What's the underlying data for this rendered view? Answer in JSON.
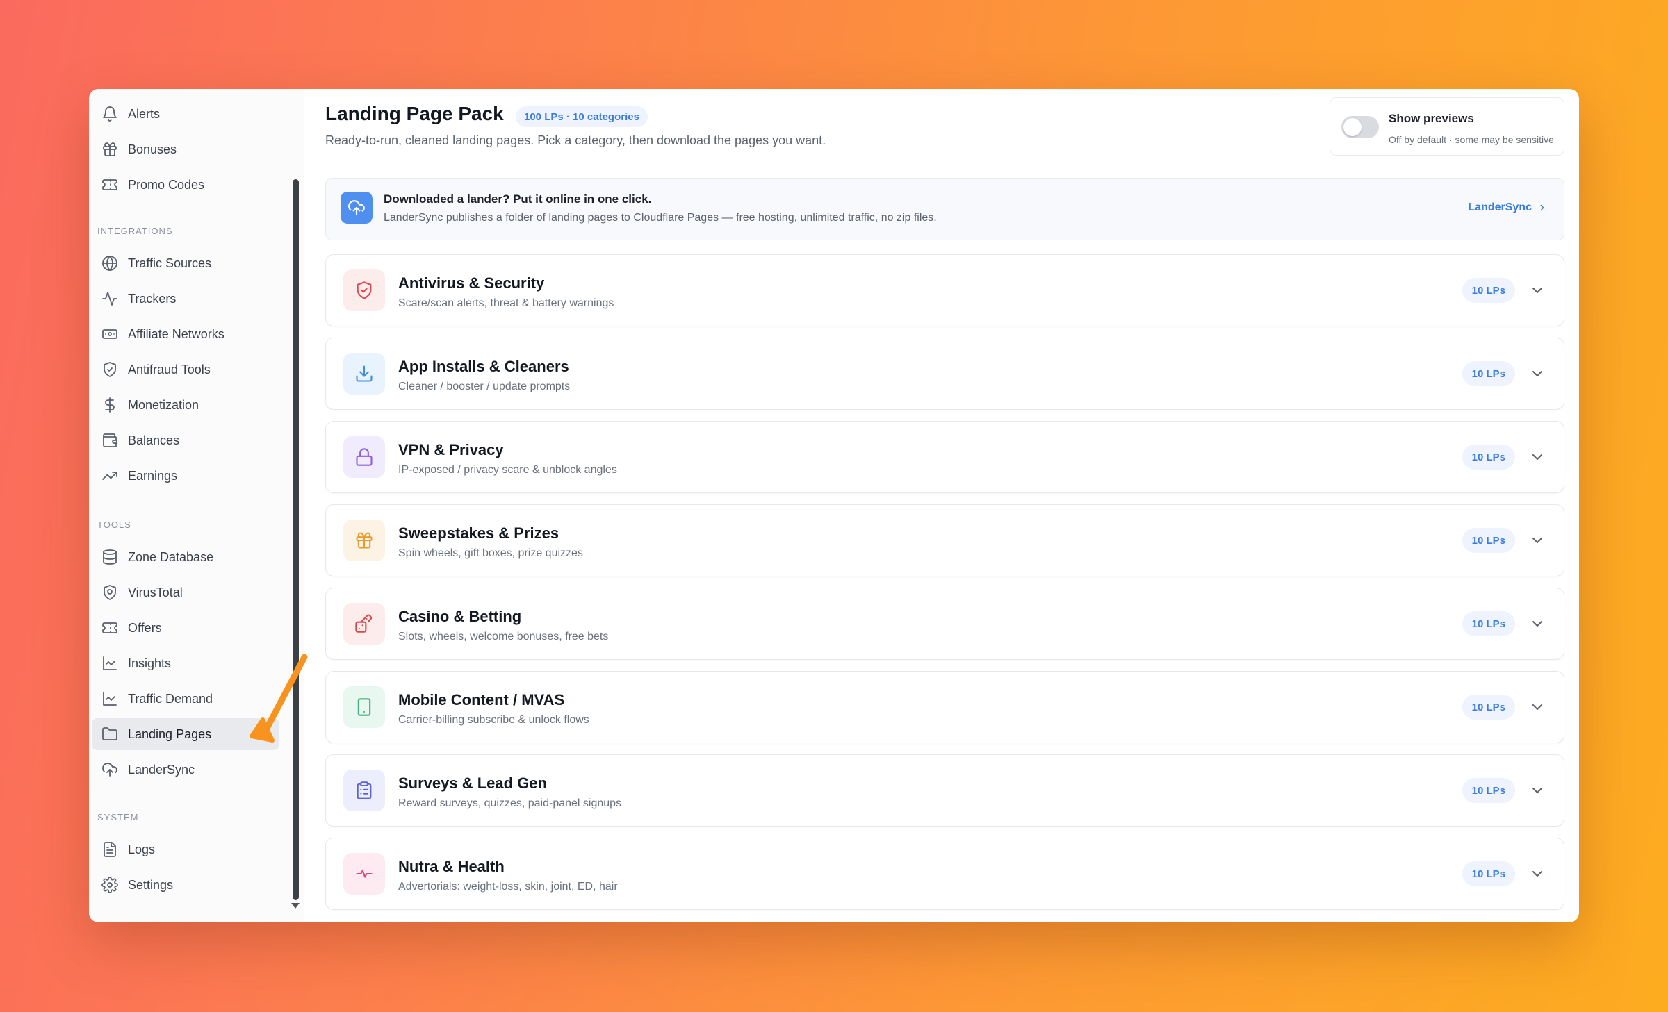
{
  "sidebar": {
    "sections": [
      {
        "label": "INTEGRATIONS"
      },
      {
        "label": "TOOLS"
      },
      {
        "label": "SYSTEM"
      }
    ],
    "items": [
      {
        "label": "Alerts",
        "icon": "bell-icon"
      },
      {
        "label": "Bonuses",
        "icon": "gift-icon"
      },
      {
        "label": "Promo Codes",
        "icon": "ticket-icon"
      },
      {
        "label": "Traffic Sources",
        "icon": "globe-icon"
      },
      {
        "label": "Trackers",
        "icon": "activity-icon"
      },
      {
        "label": "Affiliate Networks",
        "icon": "banknote-icon"
      },
      {
        "label": "Antifraud Tools",
        "icon": "shield-check-icon"
      },
      {
        "label": "Monetization",
        "icon": "dollar-icon"
      },
      {
        "label": "Balances",
        "icon": "wallet-icon"
      },
      {
        "label": "Earnings",
        "icon": "trending-up-icon"
      },
      {
        "label": "Zone Database",
        "icon": "database-icon"
      },
      {
        "label": "VirusTotal",
        "icon": "shield-scan-icon"
      },
      {
        "label": "Offers",
        "icon": "ticket-icon"
      },
      {
        "label": "Insights",
        "icon": "line-chart-icon"
      },
      {
        "label": "Traffic Demand",
        "icon": "line-chart-icon"
      },
      {
        "label": "Landing Pages",
        "icon": "folder-icon",
        "active": true
      },
      {
        "label": "LanderSync",
        "icon": "cloud-upload-icon"
      },
      {
        "label": "Logs",
        "icon": "file-text-icon"
      },
      {
        "label": "Settings",
        "icon": "gear-icon"
      }
    ]
  },
  "header": {
    "title": "Landing Page Pack",
    "badge": "100 LPs · 10 categories",
    "subtitle": "Ready-to-run, cleaned landing pages. Pick a category, then download the pages you want."
  },
  "previews": {
    "title": "Show previews",
    "subtitle": "Off by default · some may be sensitive",
    "enabled": false
  },
  "banner": {
    "title": "Downloaded a lander? Put it online in one click.",
    "text": "LanderSync publishes a folder of landing pages to Cloudflare Pages — free hosting, unlimited traffic, no zip files.",
    "link": "LanderSync"
  },
  "categories": [
    {
      "title": "Antivirus & Security",
      "desc": "Scare/scan alerts, threat & battery warnings",
      "badge": "10 LPs",
      "icon": "shield-icon",
      "color": "#e0464b",
      "bg": "#fdecec"
    },
    {
      "title": "App Installs & Cleaners",
      "desc": "Cleaner / booster / update prompts",
      "badge": "10 LPs",
      "icon": "download-icon",
      "color": "#3d8ee4",
      "bg": "#e8f3fd"
    },
    {
      "title": "VPN & Privacy",
      "desc": "IP-exposed / privacy scare & unblock angles",
      "badge": "10 LPs",
      "icon": "lock-icon",
      "color": "#8a5fe0",
      "bg": "#f1ecfd"
    },
    {
      "title": "Sweepstakes & Prizes",
      "desc": "Spin wheels, gift boxes, prize quizzes",
      "badge": "10 LPs",
      "icon": "gift-icon",
      "color": "#e99a2b",
      "bg": "#fdf3e4"
    },
    {
      "title": "Casino & Betting",
      "desc": "Slots, wheels, welcome bonuses, free bets",
      "badge": "10 LPs",
      "icon": "dice-icon",
      "color": "#d94a4a",
      "bg": "#fdecec"
    },
    {
      "title": "Mobile Content / MVAS",
      "desc": "Carrier-billing subscribe & unlock flows",
      "badge": "10 LPs",
      "icon": "smartphone-icon",
      "color": "#3fb37a",
      "bg": "#e8f7ef"
    },
    {
      "title": "Surveys & Lead Gen",
      "desc": "Reward surveys, quizzes, paid-panel signups",
      "badge": "10 LPs",
      "icon": "clipboard-icon",
      "color": "#5b63d8",
      "bg": "#eceefd"
    },
    {
      "title": "Nutra & Health",
      "desc": "Advertorials: weight-loss, skin, joint, ED, hair",
      "badge": "10 LPs",
      "icon": "heartbeat-icon",
      "color": "#e0467a",
      "bg": "#fdebf1"
    }
  ],
  "colors": {
    "accent": "#3b7ddd",
    "annotation_arrow": "#f7931e"
  }
}
